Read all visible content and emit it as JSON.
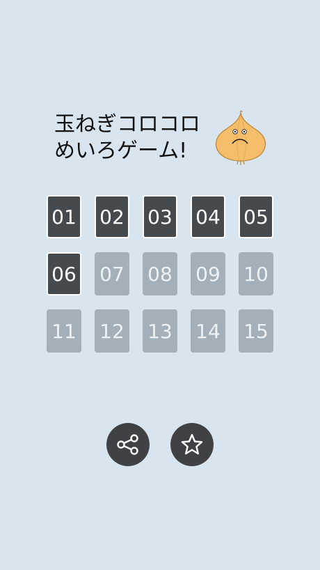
{
  "title": {
    "line1": "玉ねぎコロコロ",
    "line2": "めいろゲーム!"
  },
  "mascot": {
    "icon": "onion-mascot-icon",
    "body_color": "#f6bd6a"
  },
  "levels": [
    {
      "label": "01",
      "unlocked": true
    },
    {
      "label": "02",
      "unlocked": true
    },
    {
      "label": "03",
      "unlocked": true
    },
    {
      "label": "04",
      "unlocked": true
    },
    {
      "label": "05",
      "unlocked": true
    },
    {
      "label": "06",
      "unlocked": true
    },
    {
      "label": "07",
      "unlocked": false
    },
    {
      "label": "08",
      "unlocked": false
    },
    {
      "label": "09",
      "unlocked": false
    },
    {
      "label": "10",
      "unlocked": false
    },
    {
      "label": "11",
      "unlocked": false
    },
    {
      "label": "12",
      "unlocked": false
    },
    {
      "label": "13",
      "unlocked": false
    },
    {
      "label": "14",
      "unlocked": false
    },
    {
      "label": "15",
      "unlocked": false
    }
  ],
  "buttons": {
    "share_icon": "share-icon",
    "favorite_icon": "star-icon"
  },
  "colors": {
    "background": "#d8e4ee",
    "level_unlocked": "#454a4e",
    "level_locked": "#a3afb9",
    "round_button": "#3f4144"
  }
}
